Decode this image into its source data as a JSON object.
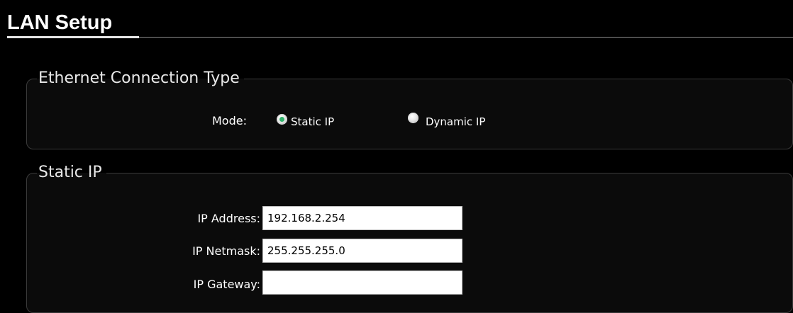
{
  "page": {
    "title": "LAN Setup"
  },
  "ethernet": {
    "legend": "Ethernet Connection Type",
    "mode_label": "Mode:",
    "options": [
      {
        "label": "Static IP",
        "selected": true
      },
      {
        "label": "Dynamic IP",
        "selected": false
      }
    ]
  },
  "static_ip": {
    "legend": "Static IP",
    "fields": [
      {
        "label": "IP Address:",
        "value": "192.168.2.254"
      },
      {
        "label": "IP Netmask:",
        "value": "255.255.255.0"
      },
      {
        "label": "IP Gateway:",
        "value": ""
      }
    ]
  },
  "colors": {
    "background": "#000000",
    "panel_border": "#3a3a3a",
    "selected_radio": "#2fb36a",
    "text": "#ffffff"
  }
}
